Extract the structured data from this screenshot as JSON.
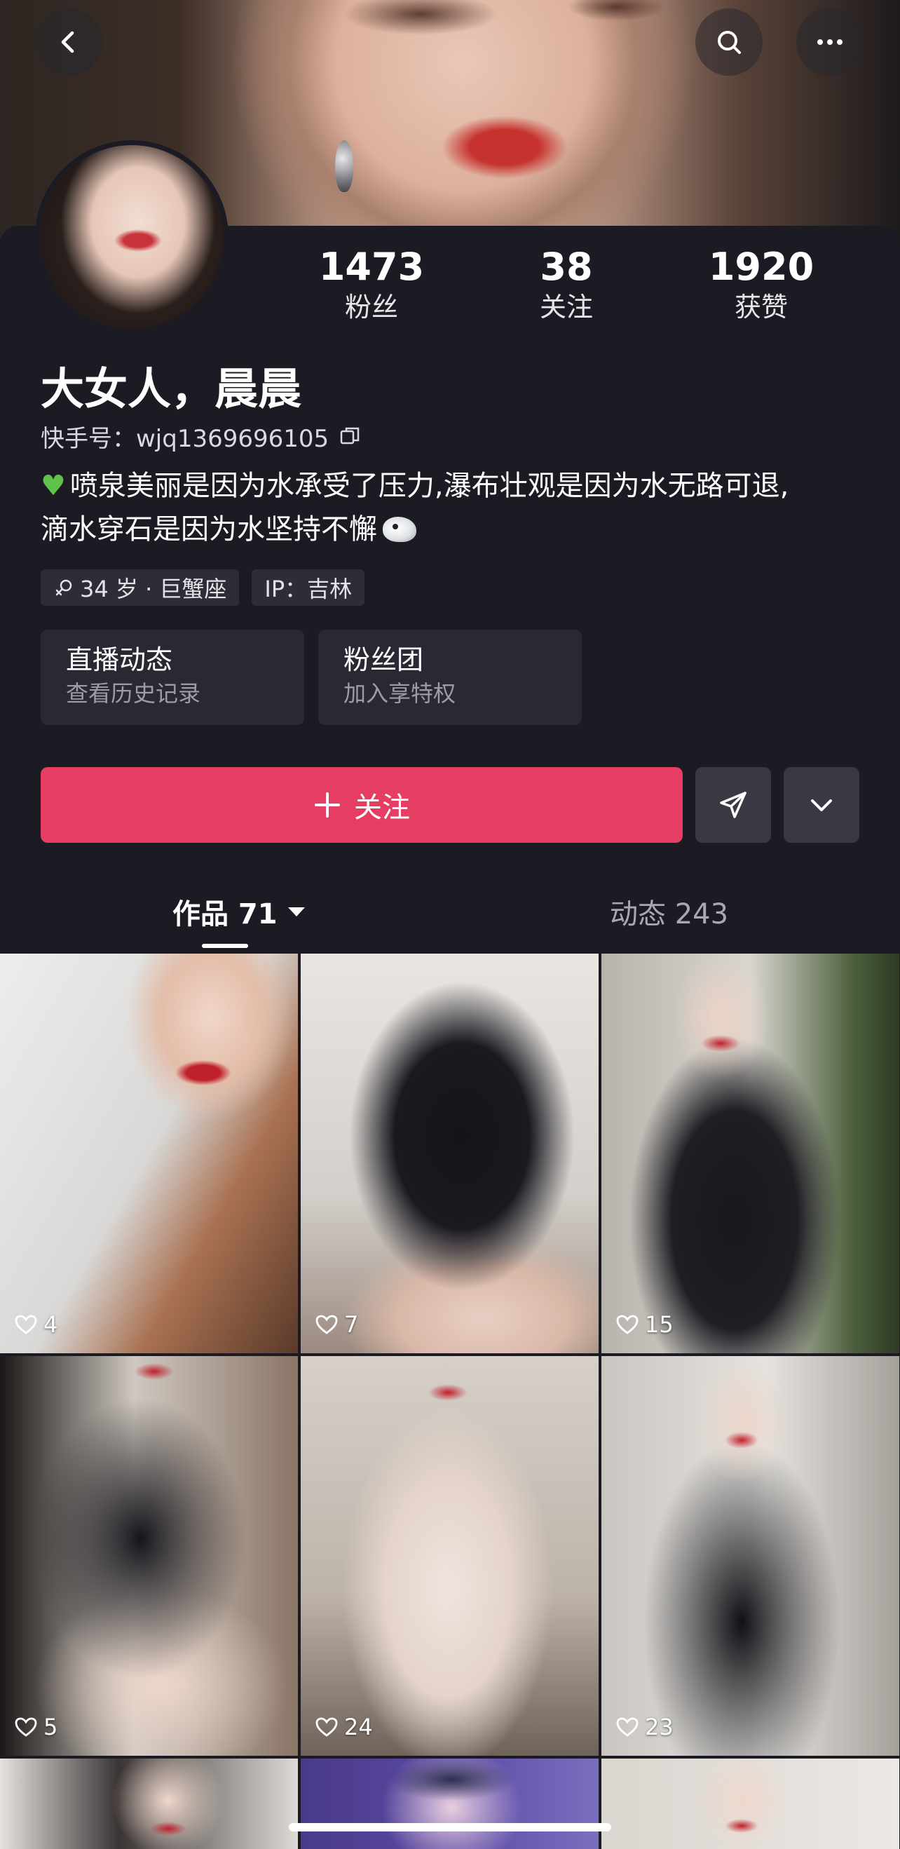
{
  "header": {
    "back_icon": "chevron-left-icon",
    "search_icon": "search-icon",
    "more_icon": "more-dots-icon"
  },
  "profile": {
    "stats": [
      {
        "value": "1473",
        "label": "粉丝"
      },
      {
        "value": "38",
        "label": "关注"
      },
      {
        "value": "1920",
        "label": "获赞"
      }
    ],
    "name": "大女人，晨晨",
    "kuaishou_id": "快手号：wjq1369696105",
    "bio_line1": "喷泉美丽是因为水承受了压力,瀑布壮观是因为水无路可退,",
    "bio_line2": "滴水穿石是因为水坚持不懈",
    "tags": {
      "age": "34 岁 · 巨蟹座",
      "ip": "IP：吉林"
    },
    "cards": [
      {
        "title": "直播动态",
        "subtitle": "查看历史记录"
      },
      {
        "title": "粉丝团",
        "subtitle": "加入享特权"
      }
    ],
    "follow_label": "关注"
  },
  "tabs": {
    "works": "作品 71",
    "moments": "动态 243"
  },
  "grid": [
    {
      "likes": "4"
    },
    {
      "likes": "7"
    },
    {
      "likes": "15"
    },
    {
      "likes": "5"
    },
    {
      "likes": "24"
    },
    {
      "likes": "23"
    }
  ],
  "colors": {
    "background": "#1c1b24",
    "follow_button": "#e63d63",
    "card": "#2a2933"
  }
}
